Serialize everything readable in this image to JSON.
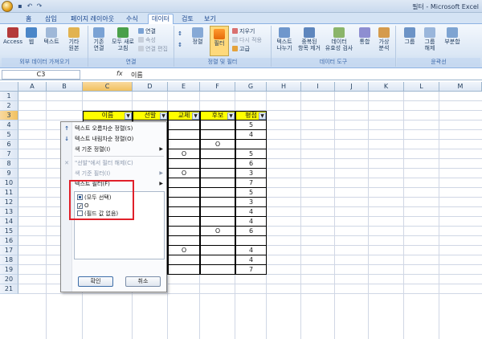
{
  "window": {
    "title": "필터 - Microsoft Excel"
  },
  "tabs": [
    "홈",
    "삽입",
    "페이지 레이아웃",
    "수식",
    "데이터",
    "검토",
    "보기"
  ],
  "active_tab": "데이터",
  "ribbon": {
    "external": {
      "label": "외부 데이터 가져오기",
      "access": "Access",
      "web": "웹",
      "text": "텍스트",
      "other_1": "기타",
      "other_2": "원본"
    },
    "connections": {
      "label": "연결",
      "existing_1": "기존",
      "existing_2": "연결",
      "refresh_1": "모두 새로",
      "refresh_2": "고침",
      "connections": "연결",
      "properties": "속성",
      "edit_links": "연결 편집"
    },
    "sort_filter": {
      "label": "정렬 및 필터",
      "sort": "정렬",
      "filter": "필터",
      "clear": "지우기",
      "reapply": "다시 적용",
      "advanced": "고급"
    },
    "data_tools": {
      "label": "데이터 도구",
      "text_to_columns_1": "텍스트",
      "text_to_columns_2": "나누기",
      "remove_dup_1": "중복된",
      "remove_dup_2": "항목 제거",
      "validation_1": "데이터",
      "validation_2": "유효성 검사",
      "consolidate": "통합",
      "what_if_1": "가상",
      "what_if_2": "분석"
    },
    "outline": {
      "label": "윤곽선",
      "group": "그룹",
      "ungroup_1": "그룹",
      "ungroup_2": "해제",
      "subtotal": "부분합"
    }
  },
  "formula_bar": {
    "name_box": "C3",
    "fx": "fx",
    "value": "이름"
  },
  "grid": {
    "columns": [
      "A",
      "B",
      "C",
      "D",
      "E",
      "F",
      "G",
      "H",
      "I",
      "J",
      "K",
      "L",
      "M"
    ],
    "rows": [
      "1",
      "2",
      "3",
      "4",
      "5",
      "6",
      "7",
      "8",
      "9",
      "10",
      "11",
      "12",
      "13",
      "14",
      "15",
      "16",
      "17",
      "18",
      "19",
      "20",
      "21"
    ],
    "headers": [
      "이름",
      "선발",
      "교체",
      "후보",
      "평점"
    ],
    "column_e": [
      "",
      "",
      "",
      "O",
      "",
      "O",
      "",
      "",
      "",
      "",
      "",
      "",
      "",
      "O",
      "",
      ""
    ],
    "column_f": [
      "",
      "",
      "O",
      "",
      "",
      "",
      "",
      "",
      "",
      "",
      "",
      "O",
      "",
      "",
      "",
      ""
    ],
    "column_g": [
      "5",
      "4",
      "",
      "5",
      "6",
      "3",
      "7",
      "5",
      "3",
      "4",
      "4",
      "6",
      "",
      "4",
      "4",
      "7"
    ]
  },
  "dropdown": {
    "items": [
      "텍스트 오름차순 정렬(S)",
      "텍스트 내림차순 정렬(O)",
      "색 기준 정렬(I)",
      "\"선발\"에서 필터 해제(C)",
      "색 기준 필터(I)",
      "텍스트 필터(F)"
    ],
    "filter_options": [
      "(모두 선택)",
      "O",
      "(필드 값 없음)"
    ],
    "ok": "확인",
    "cancel": "취소"
  },
  "colors": {
    "header_fill": "#ffff00",
    "highlight": "#e0202a",
    "ribbon": "#dbe7f5"
  }
}
